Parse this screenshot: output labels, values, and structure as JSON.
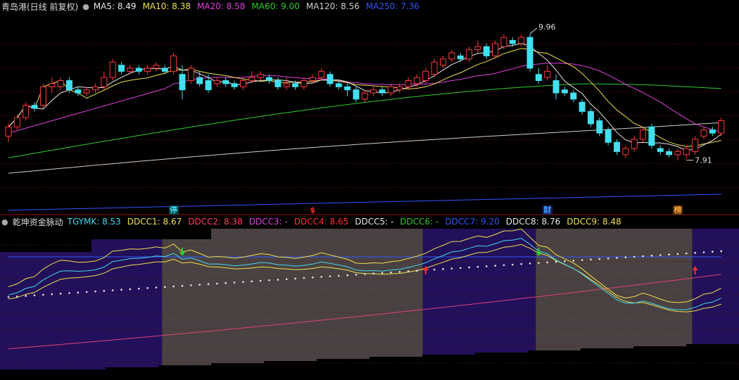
{
  "main_header": {
    "title": "青岛港(日线 前复权)",
    "items": [
      {
        "label": "MA5: 8.49",
        "color": "#e8e8e8"
      },
      {
        "label": "MA10: 8.38",
        "color": "#f0e04c"
      },
      {
        "label": "MA20: 8.58",
        "color": "#e040e0"
      },
      {
        "label": "MA60: 9.00",
        "color": "#2ecc2e"
      },
      {
        "label": "MA120: 8.56",
        "color": "#cfcfcf"
      },
      {
        "label": "MA250: 7.36",
        "color": "#3355ff"
      }
    ]
  },
  "sub_header": {
    "title": "乾坤资金脉动",
    "items": [
      {
        "label": "TGYMK: 8.53",
        "color": "#40d8f0"
      },
      {
        "label": "DDCC1: 8.67",
        "color": "#f0e04c"
      },
      {
        "label": "DDCC2: 8.38",
        "color": "#ff4060"
      },
      {
        "label": "DDCC3: -",
        "color": "#e040e0"
      },
      {
        "label": "DDCC4: 8.65",
        "color": "#ff3030"
      },
      {
        "label": "DDCC5: -",
        "color": "#e8e8e8"
      },
      {
        "label": "DDCC6: -",
        "color": "#2ecc2e"
      },
      {
        "label": "DDCC7: 9.20",
        "color": "#3355ff"
      },
      {
        "label": "DDCC8: 8.76",
        "color": "#e8e8e8"
      },
      {
        "label": "DDCC9: 8.48",
        "color": "#f0e04c"
      }
    ]
  },
  "events": [
    {
      "text": "停",
      "color": "#40d8f0",
      "bg": "#004444",
      "bar": 19
    },
    {
      "text": "$",
      "color": "#ff3030",
      "bg": "",
      "bar": 35
    },
    {
      "text": "财",
      "color": "#40a0ff",
      "bg": "#1a1a60",
      "bar": 62
    },
    {
      "text": "榜",
      "color": "#ffaa40",
      "bg": "#553300",
      "bar": 77
    }
  ],
  "chart_data": [
    {
      "type": "candlestick",
      "price_range": [
        7.2,
        10.3
      ],
      "annotations": [
        {
          "text": "9.96",
          "bar": 60,
          "price": 9.96
        },
        {
          "text": "7.91",
          "bar": 78,
          "price": 7.91
        }
      ],
      "candles": [
        [
          8.3,
          8.45,
          8.2,
          8.5
        ],
        [
          8.45,
          8.6,
          8.4,
          8.65
        ],
        [
          8.6,
          8.8,
          8.55,
          8.85
        ],
        [
          8.8,
          8.75,
          8.7,
          8.85
        ],
        [
          8.8,
          9.1,
          8.75,
          9.15
        ],
        [
          9.1,
          9.15,
          9.0,
          9.25
        ],
        [
          9.1,
          9.2,
          9.05,
          9.25
        ],
        [
          9.2,
          9.05,
          9.0,
          9.25
        ],
        [
          9.05,
          9.0,
          8.95,
          9.1
        ],
        [
          9.0,
          9.05,
          8.95,
          9.1
        ],
        [
          9.05,
          9.1,
          9.0,
          9.15
        ],
        [
          9.1,
          9.25,
          9.05,
          9.35
        ],
        [
          9.25,
          9.5,
          9.2,
          9.55
        ],
        [
          9.45,
          9.35,
          9.3,
          9.5
        ],
        [
          9.35,
          9.4,
          9.3,
          9.45
        ],
        [
          9.4,
          9.35,
          9.3,
          9.45
        ],
        [
          9.35,
          9.4,
          9.3,
          9.45
        ],
        [
          9.4,
          9.45,
          9.35,
          9.5
        ],
        [
          9.4,
          9.35,
          9.3,
          9.45
        ],
        [
          9.35,
          9.6,
          9.3,
          9.65
        ],
        [
          9.3,
          9.05,
          8.9,
          9.45
        ],
        [
          9.2,
          9.4,
          9.15,
          9.45
        ],
        [
          9.25,
          9.15,
          9.1,
          9.35
        ],
        [
          9.2,
          9.05,
          9.0,
          9.3
        ],
        [
          9.15,
          9.2,
          9.1,
          9.25
        ],
        [
          9.2,
          9.15,
          9.1,
          9.25
        ],
        [
          9.15,
          9.1,
          9.05,
          9.2
        ],
        [
          9.1,
          9.2,
          9.05,
          9.25
        ],
        [
          9.2,
          9.25,
          9.15,
          9.35
        ],
        [
          9.25,
          9.3,
          9.2,
          9.35
        ],
        [
          9.25,
          9.2,
          9.15,
          9.3
        ],
        [
          9.2,
          9.1,
          9.05,
          9.25
        ],
        [
          9.1,
          9.15,
          9.05,
          9.25
        ],
        [
          9.15,
          9.1,
          9.05,
          9.2
        ],
        [
          9.1,
          9.2,
          9.05,
          9.25
        ],
        [
          9.2,
          9.25,
          9.15,
          9.3
        ],
        [
          9.25,
          9.35,
          9.2,
          9.4
        ],
        [
          9.3,
          9.15,
          9.1,
          9.35
        ],
        [
          9.15,
          9.1,
          9.05,
          9.2
        ],
        [
          9.1,
          9.05,
          8.95,
          9.15
        ],
        [
          9.05,
          8.9,
          8.85,
          9.1
        ],
        [
          8.9,
          9.0,
          8.85,
          9.05
        ],
        [
          9.0,
          9.05,
          8.95,
          9.1
        ],
        [
          9.05,
          9.0,
          8.95,
          9.1
        ],
        [
          9.0,
          9.1,
          8.95,
          9.15
        ],
        [
          9.05,
          9.1,
          9.0,
          9.15
        ],
        [
          9.1,
          9.2,
          9.05,
          9.25
        ],
        [
          9.15,
          9.25,
          9.1,
          9.3
        ],
        [
          9.2,
          9.35,
          9.15,
          9.4
        ],
        [
          9.3,
          9.5,
          9.25,
          9.55
        ],
        [
          9.45,
          9.55,
          9.4,
          9.6
        ],
        [
          9.55,
          9.65,
          9.5,
          9.7
        ],
        [
          9.6,
          9.55,
          9.5,
          9.65
        ],
        [
          9.55,
          9.7,
          9.5,
          9.75
        ],
        [
          9.7,
          9.75,
          9.65,
          9.85
        ],
        [
          9.75,
          9.6,
          9.55,
          9.8
        ],
        [
          9.6,
          9.8,
          9.55,
          9.85
        ],
        [
          9.75,
          9.9,
          9.7,
          9.95
        ],
        [
          9.85,
          9.8,
          9.75,
          9.9
        ],
        [
          9.8,
          9.9,
          9.75,
          9.95
        ],
        [
          9.9,
          9.4,
          9.35,
          9.96
        ],
        [
          9.3,
          9.2,
          9.15,
          9.4
        ],
        [
          9.25,
          9.35,
          9.2,
          9.45
        ],
        [
          9.2,
          9.0,
          8.9,
          9.3
        ],
        [
          9.05,
          9.0,
          8.95,
          9.1
        ],
        [
          9.0,
          8.9,
          8.85,
          9.05
        ],
        [
          8.85,
          8.7,
          8.65,
          8.9
        ],
        [
          8.7,
          8.5,
          8.45,
          8.75
        ],
        [
          8.55,
          8.35,
          8.3,
          8.6
        ],
        [
          8.4,
          8.2,
          8.15,
          8.45
        ],
        [
          8.2,
          8.05,
          8.0,
          8.25
        ],
        [
          8.0,
          8.1,
          7.95,
          8.15
        ],
        [
          8.1,
          8.25,
          8.05,
          8.3
        ],
        [
          8.25,
          8.4,
          8.2,
          8.45
        ],
        [
          8.45,
          8.15,
          8.1,
          8.5
        ],
        [
          8.1,
          8.05,
          8.0,
          8.15
        ],
        [
          8.05,
          8.0,
          7.95,
          8.1
        ],
        [
          8.0,
          8.05,
          7.91,
          8.1
        ],
        [
          8.0,
          8.1,
          7.95,
          8.15
        ],
        [
          8.05,
          8.25,
          8.0,
          8.3
        ],
        [
          8.3,
          8.4,
          8.25,
          8.45
        ],
        [
          8.4,
          8.35,
          8.3,
          8.45
        ],
        [
          8.35,
          8.55,
          8.3,
          8.6
        ]
      ]
    },
    {
      "type": "indicator",
      "value_range": [
        6.4,
        9.8
      ],
      "regions": [
        {
          "from": 0,
          "to": 18,
          "kind": "blue"
        },
        {
          "from": 18,
          "to": 48,
          "kind": "gray"
        },
        {
          "from": 48,
          "to": 61,
          "kind": "blue"
        },
        {
          "from": 61,
          "to": 79,
          "kind": "gray"
        },
        {
          "from": 79,
          "to": 84,
          "kind": "blue"
        }
      ],
      "signals": [
        {
          "bar": 20,
          "dir": "down",
          "color": "#2ecc2e"
        },
        {
          "bar": 48,
          "dir": "up",
          "color": "#ff3030"
        },
        {
          "bar": 61,
          "dir": "down",
          "color": "#2ecc2e"
        },
        {
          "bar": 79,
          "dir": "up",
          "color": "#ff3030"
        }
      ]
    }
  ]
}
